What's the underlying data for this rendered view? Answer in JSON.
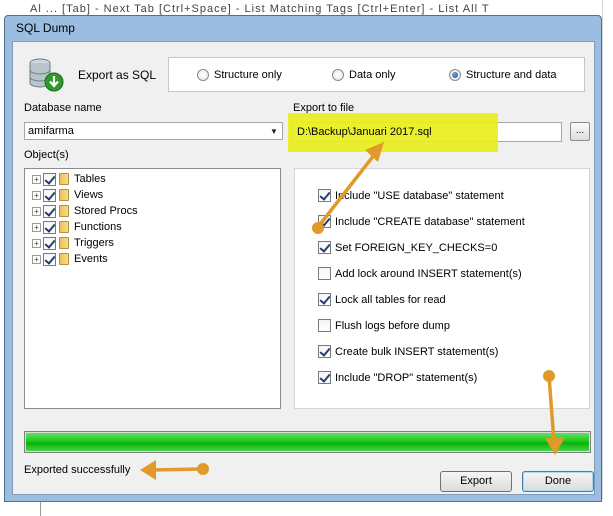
{
  "background": {
    "text": "Al ... [Tab] - Next Tab [Ctrl+Space] - List Matching Tags [Ctrl+Enter] - List All T"
  },
  "window": {
    "title": "SQL Dump"
  },
  "export_as": {
    "label": "Export as SQL",
    "options": [
      "Structure only",
      "Data only",
      "Structure and data"
    ],
    "selected": "Structure and data"
  },
  "database": {
    "label": "Database name",
    "value": "amifarma"
  },
  "export_file": {
    "label": "Export to file",
    "value": "D:\\Backup\\Januari 2017.sql",
    "browse_label": "..."
  },
  "objects": {
    "label": "Object(s)",
    "items": [
      {
        "label": "Tables",
        "checked": true
      },
      {
        "label": "Views",
        "checked": true
      },
      {
        "label": "Stored Procs",
        "checked": true
      },
      {
        "label": "Functions",
        "checked": true
      },
      {
        "label": "Triggers",
        "checked": true
      },
      {
        "label": "Events",
        "checked": true
      }
    ]
  },
  "options": [
    {
      "label": "Include \"USE database\" statement",
      "checked": true
    },
    {
      "label": "Include \"CREATE database\" statement",
      "checked": true
    },
    {
      "label": "Set FOREIGN_KEY_CHECKS=0",
      "checked": true
    },
    {
      "label": "Add lock around INSERT statement(s)",
      "checked": false
    },
    {
      "label": "Lock all tables for read",
      "checked": true
    },
    {
      "label": "Flush logs before dump",
      "checked": false
    },
    {
      "label": "Create bulk INSERT statement(s)",
      "checked": true
    },
    {
      "label": "Include \"DROP\" statement(s)",
      "checked": true
    }
  ],
  "progress": {
    "percent": 100,
    "color": "#1ec81e"
  },
  "status": "Exported successfully",
  "buttons": {
    "export": "Export",
    "done": "Done"
  },
  "colors": {
    "highlight": "#e8ee1e",
    "annotation_arrow": "#e09a2a"
  }
}
